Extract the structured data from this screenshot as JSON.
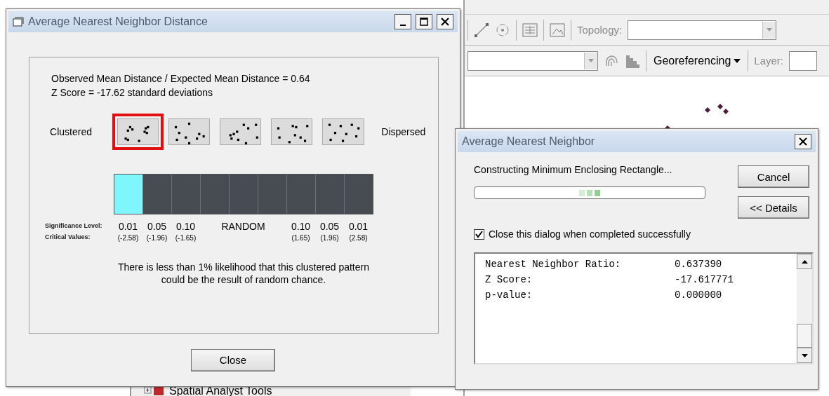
{
  "app": {
    "toolbar": {
      "topology_label": "Topology:",
      "georeferencing_menu": "Georeferencing",
      "layer_label": "Layer:"
    },
    "tree_item": "Spatial Analyst Tools"
  },
  "distance_dialog": {
    "title": "Average Nearest Neighbor Distance",
    "summary": [
      "Observed Mean Distance / Expected Mean Distance = 0.64",
      "Z Score = -17.62 standard deviations"
    ],
    "left_label": "Clustered",
    "right_label": "Dispersed",
    "patterns": [
      {
        "selected": true
      },
      {
        "selected": false
      },
      {
        "selected": false
      },
      {
        "selected": false
      },
      {
        "selected": false
      }
    ],
    "segments": [
      {
        "highlighted": true
      },
      {
        "highlighted": false
      },
      {
        "highlighted": false
      },
      {
        "highlighted": false
      },
      {
        "highlighted": false
      },
      {
        "highlighted": false
      },
      {
        "highlighted": false
      },
      {
        "highlighted": false
      },
      {
        "highlighted": false
      }
    ],
    "significance_label": "Significance Level:",
    "critical_label": "Critical Values:",
    "levels": [
      {
        "kind": "level",
        "significance": "0.01",
        "critical": "(-2.58)"
      },
      {
        "kind": "level",
        "significance": "0.05",
        "critical": "(-1.96)"
      },
      {
        "kind": "level",
        "significance": "0.10",
        "critical": "(-1.65)"
      },
      {
        "kind": "random",
        "significance": "RANDOM"
      },
      {
        "kind": "level",
        "significance": "0.10",
        "critical": "(1.65)"
      },
      {
        "kind": "level",
        "significance": "0.05",
        "critical": "(1.96)"
      },
      {
        "kind": "level",
        "significance": "0.01",
        "critical": "(2.58)"
      }
    ],
    "conclusion": [
      "There is less than 1% likelihood that this clustered pattern",
      "could be the result of random chance."
    ],
    "close_button": "Close"
  },
  "progress_dialog": {
    "title": "Average Nearest Neighbor",
    "status": "Constructing Minimum Enclosing Rectangle...",
    "busy": true,
    "cancel_button": "Cancel",
    "details_button": "<< Details",
    "close_when_done": {
      "label": "Close this dialog when completed successfully",
      "checked": true
    },
    "results": [
      {
        "label": "Nearest Neighbor Ratio:",
        "value": "0.637390"
      },
      {
        "label": "Z Score:",
        "value": "-17.617771"
      },
      {
        "label": "p-value:",
        "value": "0.000000"
      }
    ]
  }
}
